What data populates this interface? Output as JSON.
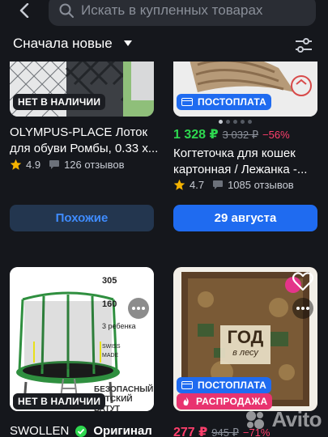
{
  "search": {
    "placeholder": "Искать в купленных товарах"
  },
  "sort": {
    "label": "Сначала новые"
  },
  "cards": [
    {
      "badge": "НЕТ В НАЛИЧИИ",
      "title_lines": [
        "OLYMPUS-PLACE Лоток",
        "для обуви Ромбы, 0.33 х..."
      ],
      "rating": "4.9",
      "reviews": "126 отзывов",
      "button": "Похожие"
    },
    {
      "badge": "ПОСТОПЛАТА",
      "price_now": "1 328 ₽",
      "price_old": "3 032 ₽",
      "discount": "−56%",
      "title_lines": [
        "Когтеточка для кошек",
        "картонная / Лежанка -..."
      ],
      "rating": "4.7",
      "reviews": "1085 отзывов",
      "button": "29 августа"
    },
    {
      "badge": "НЕТ В НАЛИЧИИ",
      "brand": "SWOLLEN",
      "original": "Оригинал",
      "overlay": {
        "diam": "305",
        "load": "160",
        "kids": "3 ребенка",
        "swiss": "SWISS MADE",
        "caption": "БЕЗОПАСНЫЙ ДЕТСКИЙ БАТУТ"
      }
    },
    {
      "badge1": "ПОСТОПЛАТА",
      "badge2": "РАСПРОДАЖА",
      "price_now": "277 ₽",
      "price_old": "945 ₽",
      "discount": "−71%",
      "book_title": "ГОД",
      "book_sub": "в лесу"
    }
  ],
  "watermark": "Avito",
  "colors": {
    "bg": "#15171c",
    "accent": "#1f6bf0",
    "green": "#2ed84f",
    "pink": "#e8336f"
  }
}
